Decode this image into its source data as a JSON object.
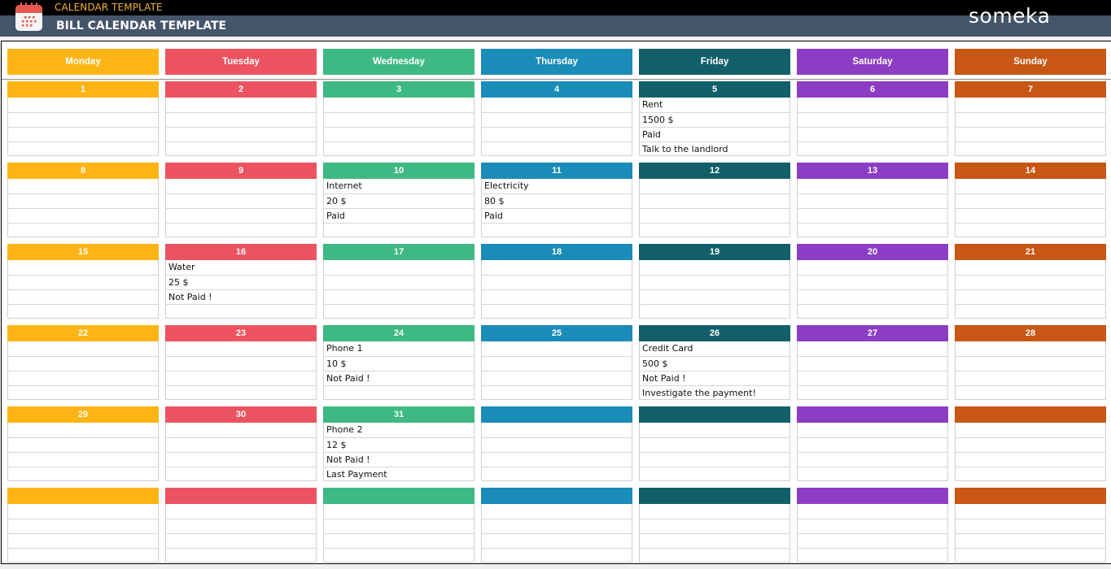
{
  "header": {
    "subtitle": "CALENDAR TEMPLATE",
    "title": "BILL CALENDAR TEMPLATE",
    "brand": "someka",
    "app_icon": "calendar-icon"
  },
  "colors": {
    "monday": "#fdb515",
    "tuesday": "#ec5360",
    "wednesday": "#3eb983",
    "thursday": "#1a8cb8",
    "friday": "#125f6a",
    "saturday": "#8b3dc4",
    "sunday": "#c85614"
  },
  "days": [
    {
      "label": "Monday",
      "key": "monday"
    },
    {
      "label": "Tuesday",
      "key": "tuesday"
    },
    {
      "label": "Wednesday",
      "key": "wednesday"
    },
    {
      "label": "Thursday",
      "key": "thursday"
    },
    {
      "label": "Friday",
      "key": "friday"
    },
    {
      "label": "Saturday",
      "key": "saturday"
    },
    {
      "label": "Sunday",
      "key": "sunday"
    }
  ],
  "weeks": [
    [
      {
        "date": "1",
        "lines": [
          "",
          "",
          "",
          ""
        ]
      },
      {
        "date": "2",
        "lines": [
          "",
          "",
          "",
          ""
        ]
      },
      {
        "date": "3",
        "lines": [
          "",
          "",
          "",
          ""
        ]
      },
      {
        "date": "4",
        "lines": [
          "",
          "",
          "",
          ""
        ]
      },
      {
        "date": "5",
        "lines": [
          "Rent",
          "1500 $",
          "Paid",
          "Talk to the landlord"
        ]
      },
      {
        "date": "6",
        "lines": [
          "",
          "",
          "",
          ""
        ]
      },
      {
        "date": "7",
        "lines": [
          "",
          "",
          "",
          ""
        ]
      }
    ],
    [
      {
        "date": "8",
        "lines": [
          "",
          "",
          "",
          ""
        ]
      },
      {
        "date": "9",
        "lines": [
          "",
          "",
          "",
          ""
        ]
      },
      {
        "date": "10",
        "lines": [
          "Internet",
          "20 $",
          "Paid",
          ""
        ]
      },
      {
        "date": "11",
        "lines": [
          "Electricity",
          "80 $",
          "Paid",
          ""
        ]
      },
      {
        "date": "12",
        "lines": [
          "",
          "",
          "",
          ""
        ]
      },
      {
        "date": "13",
        "lines": [
          "",
          "",
          "",
          ""
        ]
      },
      {
        "date": "14",
        "lines": [
          "",
          "",
          "",
          ""
        ]
      }
    ],
    [
      {
        "date": "15",
        "lines": [
          "",
          "",
          "",
          ""
        ]
      },
      {
        "date": "16",
        "lines": [
          "Water",
          "25 $",
          "Not Paid !",
          ""
        ]
      },
      {
        "date": "17",
        "lines": [
          "",
          "",
          "",
          ""
        ]
      },
      {
        "date": "18",
        "lines": [
          "",
          "",
          "",
          ""
        ]
      },
      {
        "date": "19",
        "lines": [
          "",
          "",
          "",
          ""
        ]
      },
      {
        "date": "20",
        "lines": [
          "",
          "",
          "",
          ""
        ]
      },
      {
        "date": "21",
        "lines": [
          "",
          "",
          "",
          ""
        ]
      }
    ],
    [
      {
        "date": "22",
        "lines": [
          "",
          "",
          "",
          ""
        ]
      },
      {
        "date": "23",
        "lines": [
          "",
          "",
          "",
          ""
        ]
      },
      {
        "date": "24",
        "lines": [
          "Phone 1",
          "10 $",
          "Not Paid !",
          ""
        ]
      },
      {
        "date": "25",
        "lines": [
          "",
          "",
          "",
          ""
        ]
      },
      {
        "date": "26",
        "lines": [
          "Credit Card",
          "500 $",
          "Not Paid !",
          "Investigate the payment!"
        ]
      },
      {
        "date": "27",
        "lines": [
          "",
          "",
          "",
          ""
        ]
      },
      {
        "date": "28",
        "lines": [
          "",
          "",
          "",
          ""
        ]
      }
    ],
    [
      {
        "date": "29",
        "lines": [
          "",
          "",
          "",
          ""
        ]
      },
      {
        "date": "30",
        "lines": [
          "",
          "",
          "",
          ""
        ]
      },
      {
        "date": "31",
        "lines": [
          "Phone 2",
          "12 $",
          "Not Paid !",
          "Last Payment"
        ]
      },
      {
        "date": "",
        "lines": [
          "",
          "",
          "",
          ""
        ]
      },
      {
        "date": "",
        "lines": [
          "",
          "",
          "",
          ""
        ]
      },
      {
        "date": "",
        "lines": [
          "",
          "",
          "",
          ""
        ]
      },
      {
        "date": "",
        "lines": [
          "",
          "",
          "",
          ""
        ]
      }
    ],
    [
      {
        "date": "",
        "lines": [
          "",
          "",
          "",
          ""
        ]
      },
      {
        "date": "",
        "lines": [
          "",
          "",
          "",
          ""
        ]
      },
      {
        "date": "",
        "lines": [
          "",
          "",
          "",
          ""
        ]
      },
      {
        "date": "",
        "lines": [
          "",
          "",
          "",
          ""
        ]
      },
      {
        "date": "",
        "lines": [
          "",
          "",
          "",
          ""
        ]
      },
      {
        "date": "",
        "lines": [
          "",
          "",
          "",
          ""
        ]
      },
      {
        "date": "",
        "lines": [
          "",
          "",
          "",
          ""
        ]
      }
    ]
  ]
}
